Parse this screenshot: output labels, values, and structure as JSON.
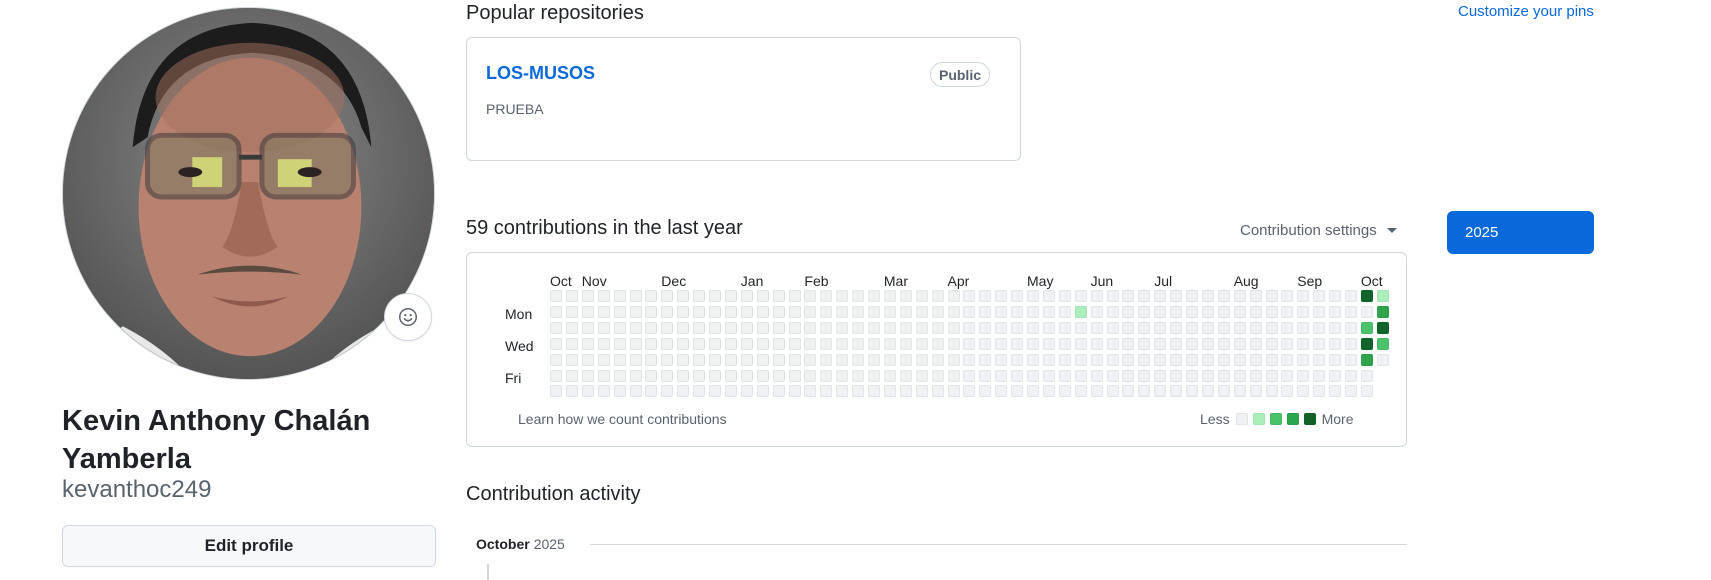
{
  "profile": {
    "full_name": "Kevin Anthony Chalán Yamberla",
    "username": "kevanthoc249",
    "edit_button": "Edit profile",
    "status_icon": "smiley-icon"
  },
  "popular": {
    "title": "Popular repositories",
    "customize_link": "Customize your pins",
    "repos": [
      {
        "name": "LOS-MUSOS",
        "visibility": "Public",
        "description": "PRUEBA"
      }
    ]
  },
  "contributions": {
    "title": "59 contributions in the last year",
    "settings_label": "Contribution settings",
    "year_button": "2025",
    "months": [
      "Oct",
      "Nov",
      "Dec",
      "Jan",
      "Feb",
      "Mar",
      "Apr",
      "May",
      "Jun",
      "Jul",
      "Aug",
      "Sep",
      "Oct"
    ],
    "days": [
      "Mon",
      "Wed",
      "Fri"
    ],
    "learn_link": "Learn how we count contributions",
    "legend_less": "Less",
    "legend_more": "More",
    "levels": [
      "#eff2f5",
      "#aceebb",
      "#4ac26b",
      "#2da44e",
      "#116329"
    ],
    "weeks": 53,
    "active_cells": [
      {
        "week": 33,
        "day": 1,
        "level": 1
      },
      {
        "week": 51,
        "day": 0,
        "level": 4
      },
      {
        "week": 51,
        "day": 2,
        "level": 2
      },
      {
        "week": 51,
        "day": 3,
        "level": 4
      },
      {
        "week": 51,
        "day": 4,
        "level": 3
      },
      {
        "week": 52,
        "day": 0,
        "level": 1
      },
      {
        "week": 52,
        "day": 1,
        "level": 3
      },
      {
        "week": 52,
        "day": 2,
        "level": 4
      },
      {
        "week": 52,
        "day": 3,
        "level": 2
      }
    ],
    "last_week_days": 5
  },
  "activity": {
    "title": "Contribution activity",
    "month": "October",
    "year": "2025"
  }
}
